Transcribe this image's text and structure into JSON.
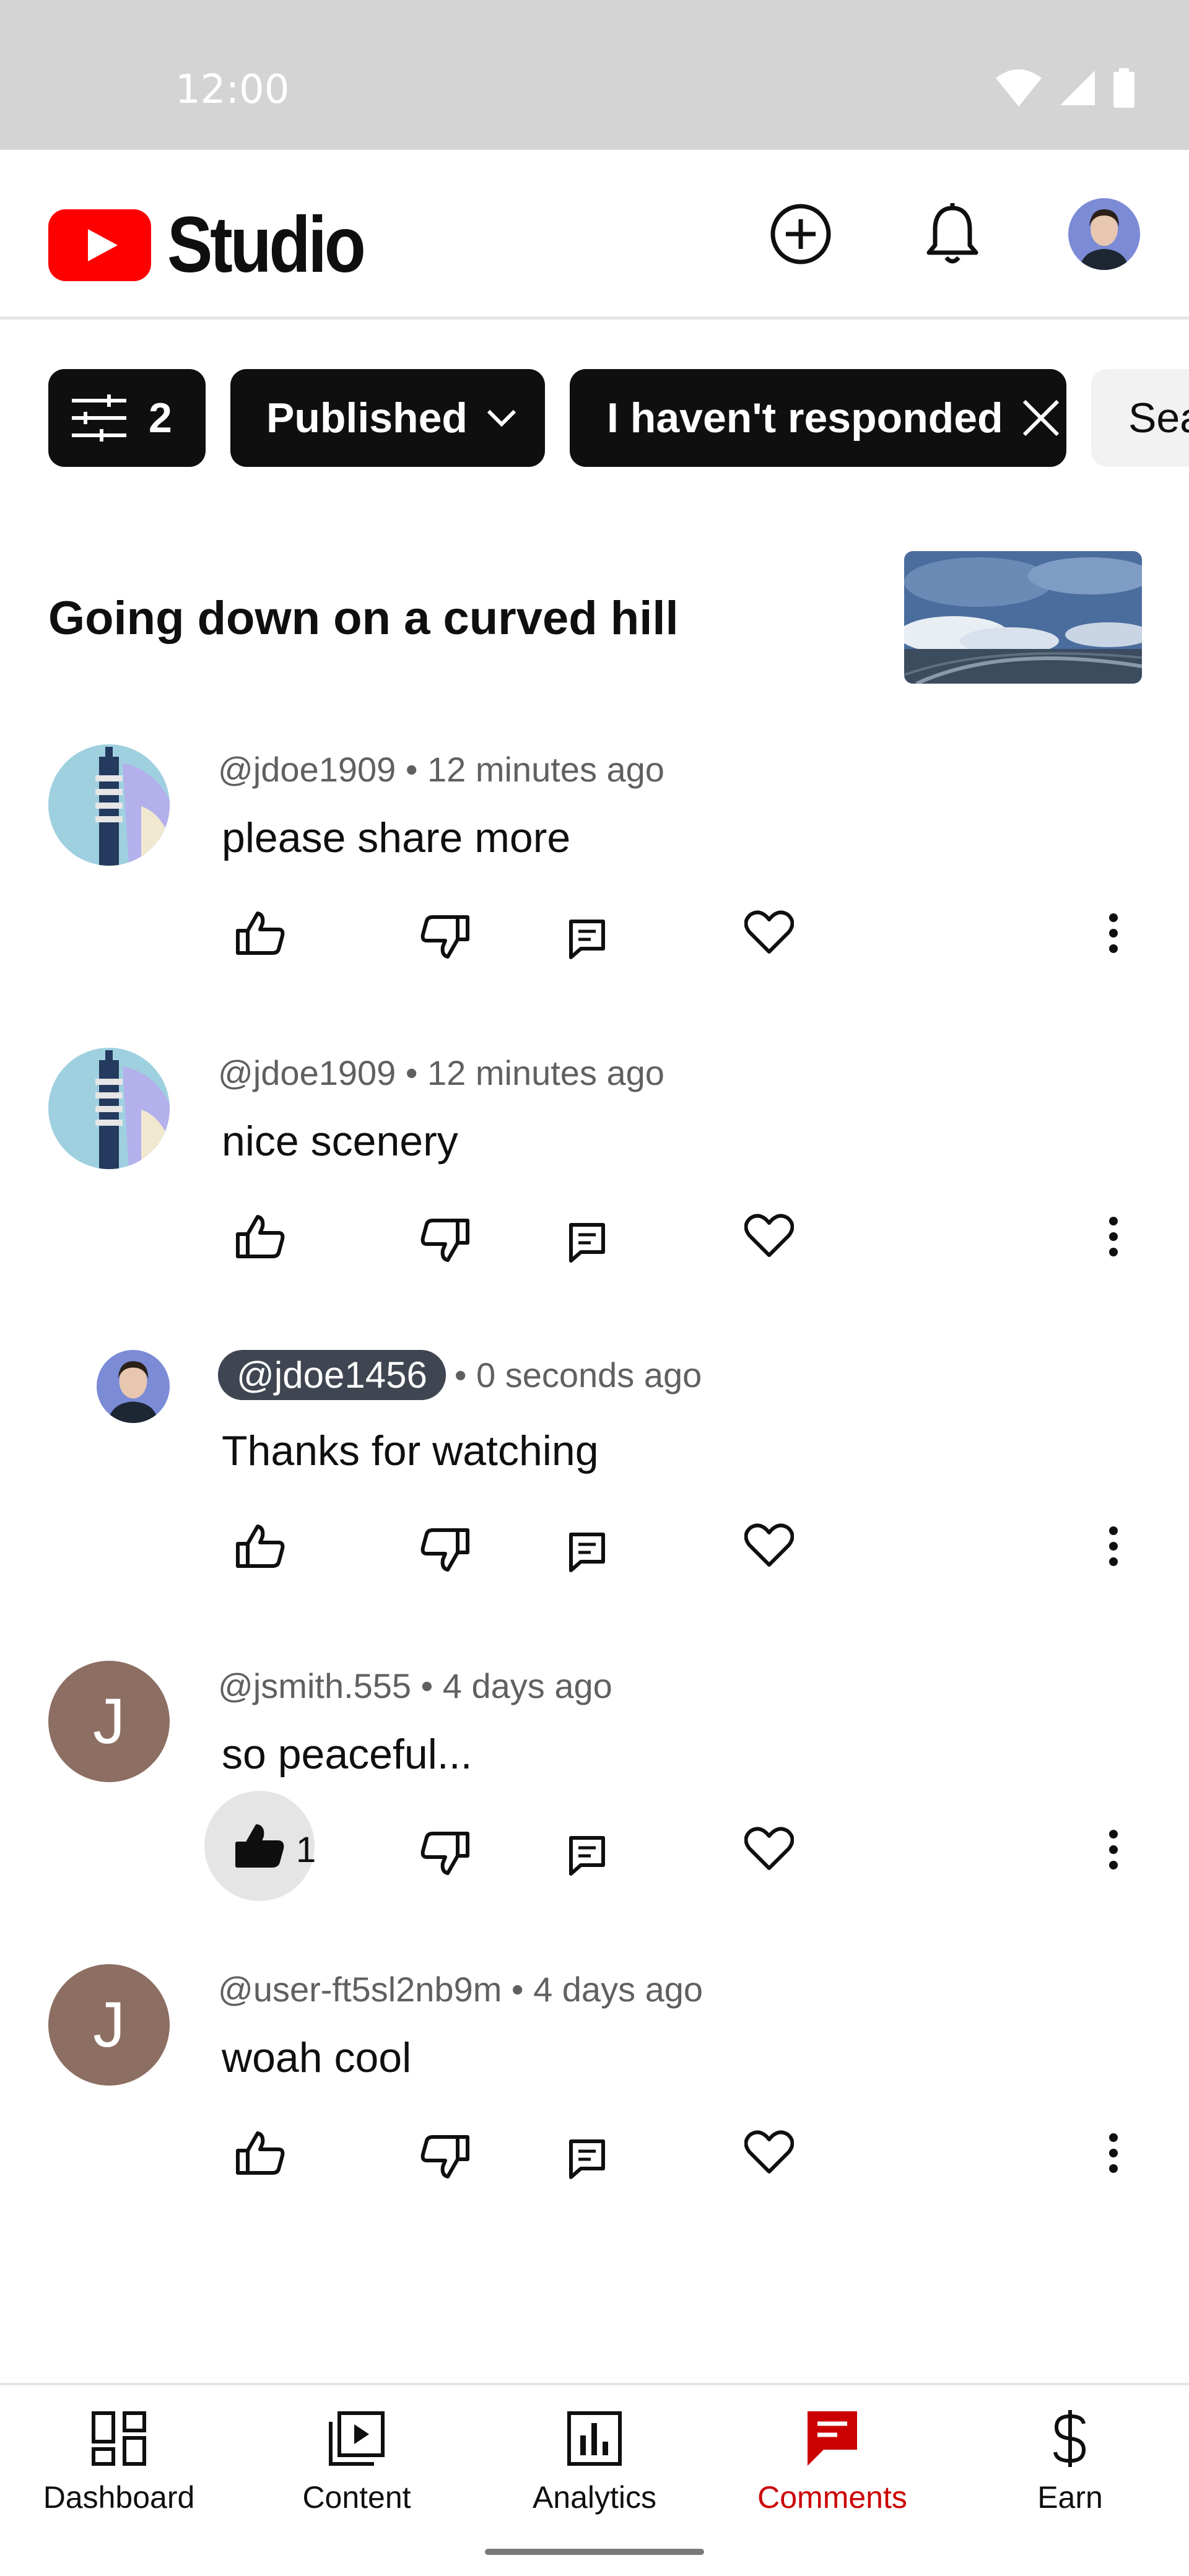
{
  "status_bar": {
    "time": "12:00"
  },
  "header": {
    "logo_text": "Studio"
  },
  "filters": {
    "count": "2",
    "published": "Published",
    "responded": "I haven't responded",
    "search": "Sea"
  },
  "video": {
    "title": "Going down on a curved hill"
  },
  "comments": [
    {
      "meta": "@jdoe1909 • 12 minutes ago",
      "text": "please share more"
    },
    {
      "meta": "@jdoe1909 • 12 minutes ago",
      "text": "nice scenery"
    },
    {
      "author": "@jdoe1456",
      "time": " • 0 seconds ago",
      "text": "Thanks for watching"
    },
    {
      "avatar_letter": "J",
      "meta": "@jsmith.555 • 4 days ago",
      "text": "so peaceful...",
      "likes": "1"
    },
    {
      "avatar_letter": "J",
      "meta": "@user-ft5sl2nb9m • 4 days ago",
      "text": "woah cool"
    }
  ],
  "nav": [
    {
      "label": "Dashboard",
      "icon": "dashboard-icon"
    },
    {
      "label": "Content",
      "icon": "content-icon"
    },
    {
      "label": "Analytics",
      "icon": "analytics-icon"
    },
    {
      "label": "Comments",
      "icon": "comments-icon",
      "active": true
    },
    {
      "label": "Earn",
      "icon": "dollar-icon"
    }
  ],
  "colors": {
    "brand_red": "#ff0000",
    "active_nav": "#cc0000",
    "chip_dark": "#0f0f0f",
    "avatar_brown": "#8d6e63"
  }
}
